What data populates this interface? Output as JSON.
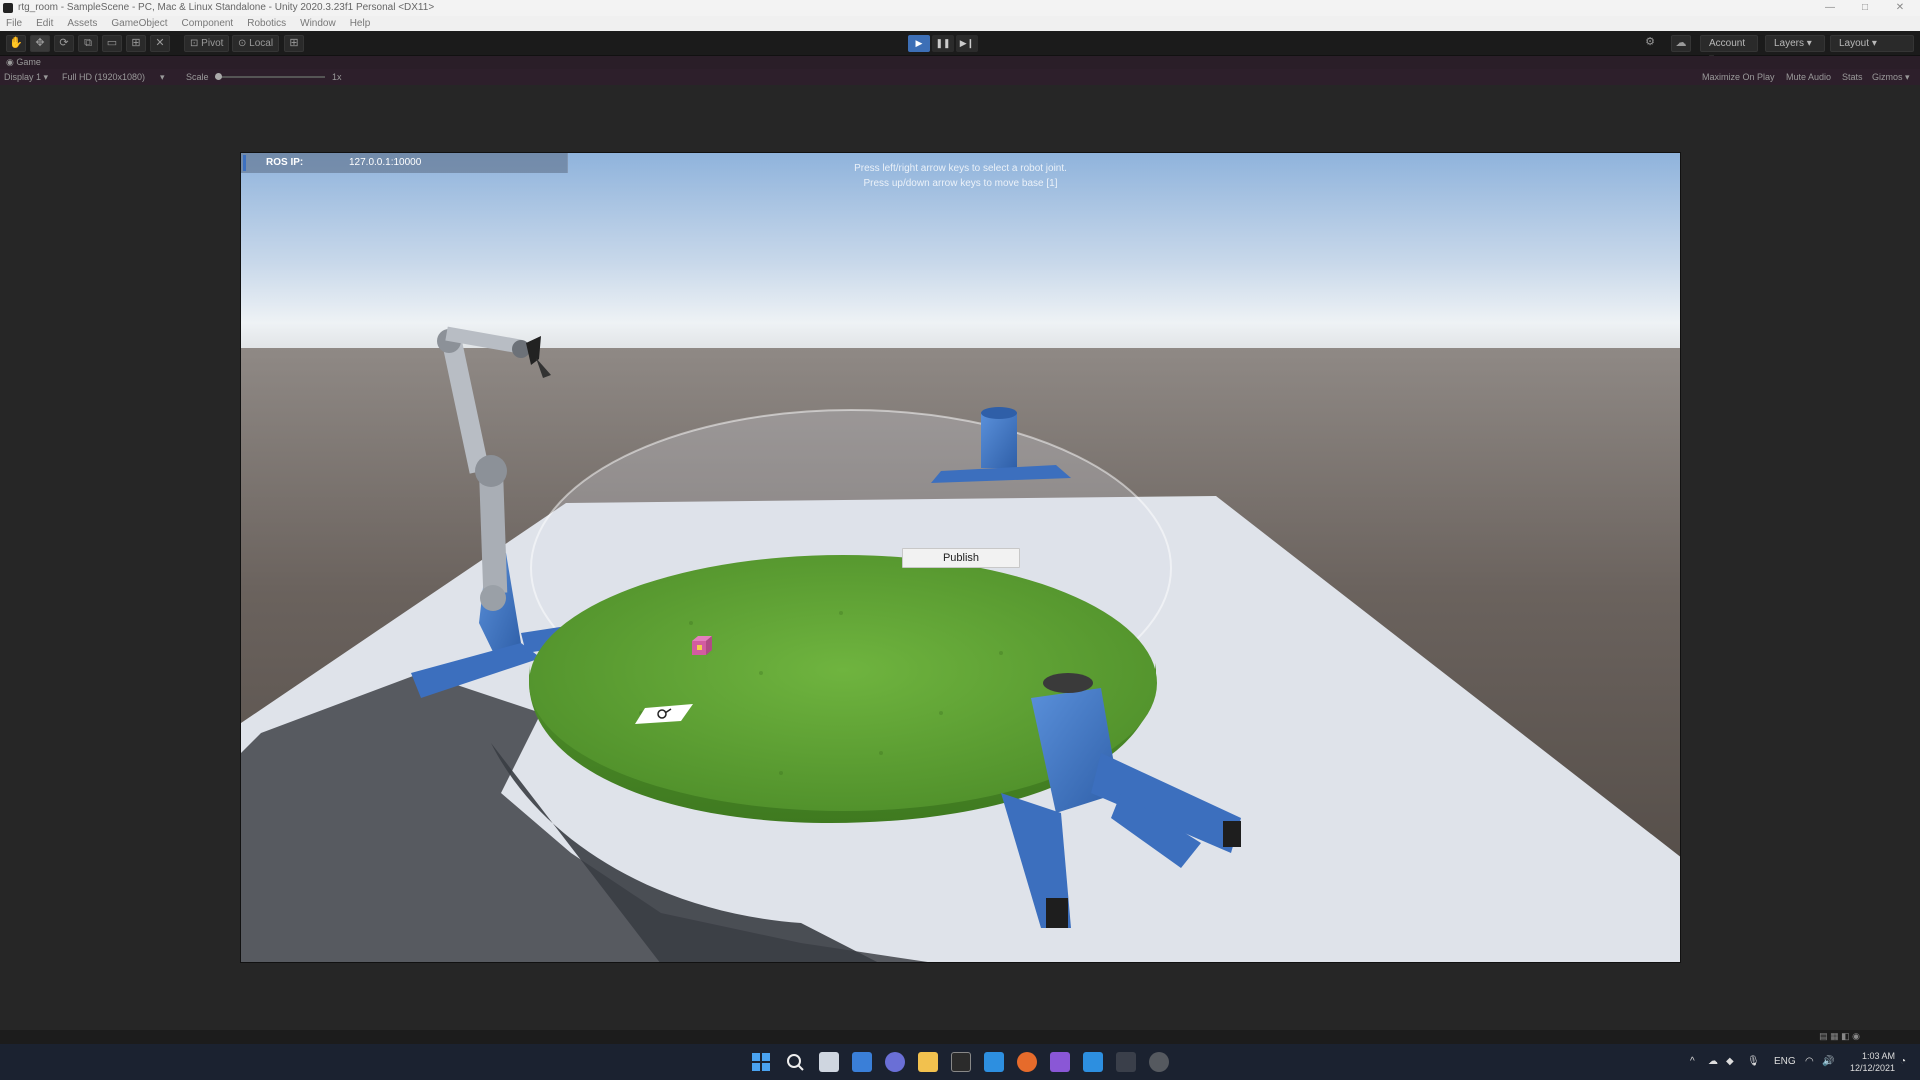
{
  "window": {
    "title": "rtg_room - SampleScene - PC, Mac & Linux Standalone - Unity 2020.3.23f1 Personal <DX11>",
    "controls": [
      "—",
      "□",
      "✕"
    ]
  },
  "menu": [
    "File",
    "Edit",
    "Assets",
    "GameObject",
    "Component",
    "Robotics",
    "Window",
    "Help"
  ],
  "toolbar": {
    "tools": [
      "hand-tool",
      "move-tool",
      "rotate-tool",
      "scale-tool",
      "rect-tool",
      "transform-tool",
      "custom-tool"
    ],
    "pivot_label": "Pivot",
    "local_label": "Local",
    "account_label": "Account",
    "layers_label": "Layers",
    "layout_label": "Layout",
    "play_active": true
  },
  "tab": {
    "label": "Game"
  },
  "game_bar": {
    "display": "Display 1",
    "resolution": "Full HD (1920x1080)",
    "scale_label": "Scale",
    "scale_value": "1x",
    "maximize": "Maximize On Play",
    "mute": "Mute Audio",
    "stats": "Stats",
    "gizmos": "Gizmos"
  },
  "scene": {
    "ros_label": "ROS IP:",
    "ros_value": "127.0.0.1:10000",
    "hint_line1": "Press left/right arrow keys to select a robot joint.",
    "hint_line2": "Press up/down arrow keys to move base [1]",
    "publish_label": "Publish"
  },
  "taskbar": {
    "lang": "ENG",
    "time": "1:03 AM",
    "date": "12/12/2021"
  },
  "colors": {
    "accent": "#3d6fb6",
    "sky_top": "#8fb3dc",
    "ground": "#5e5652",
    "table": "#dfe3ea",
    "grass": "#5e9c33",
    "robot_blue": "#3f78c8"
  }
}
